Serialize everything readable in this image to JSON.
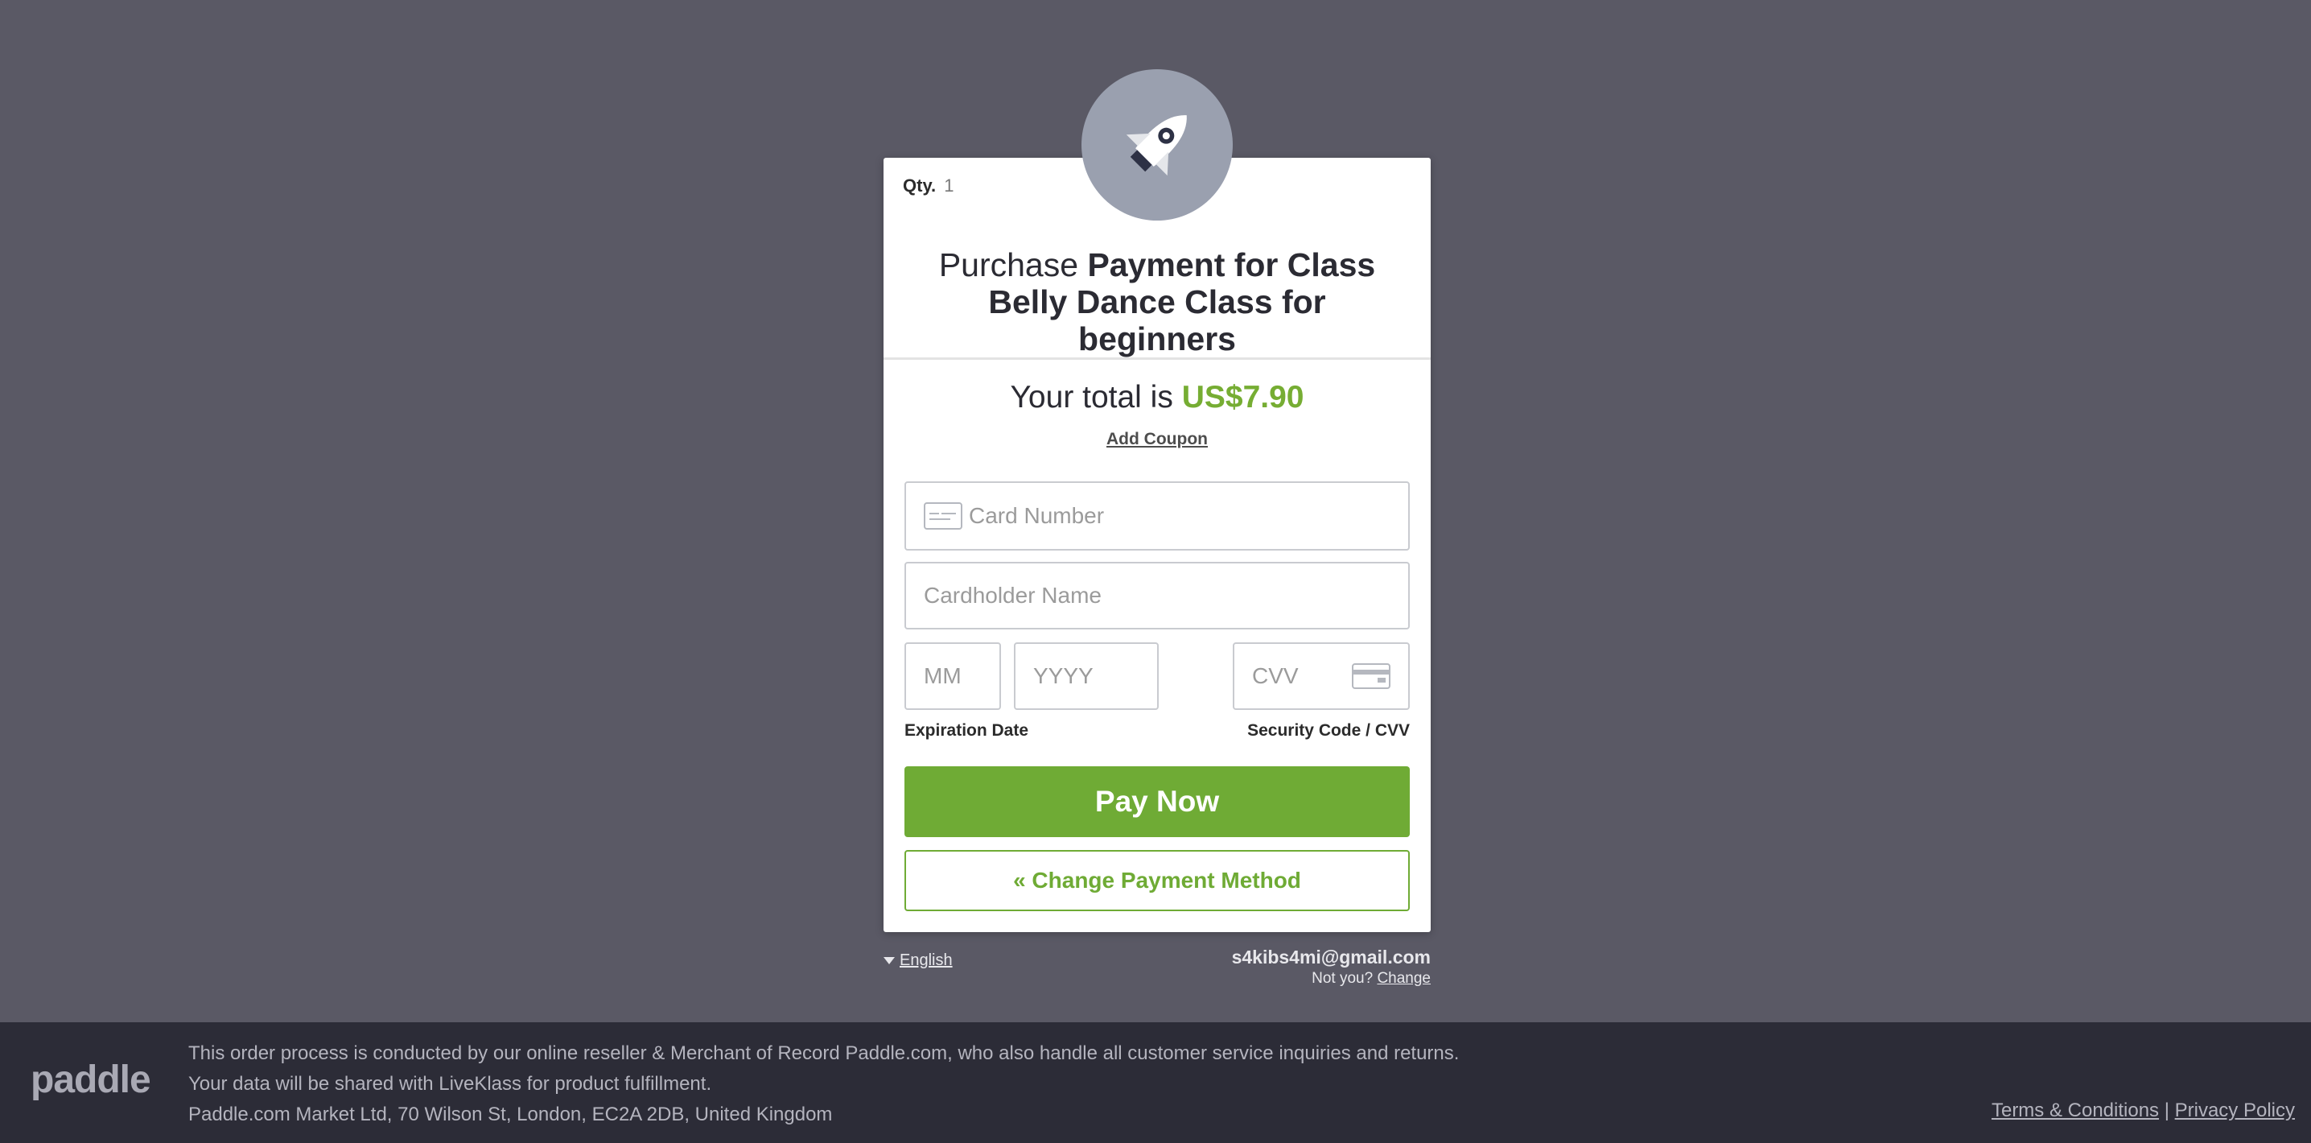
{
  "product": {
    "qty_label": "Qty.",
    "qty_value": "1",
    "title_prefix": "Purchase",
    "title_name": "Payment for Class Belly Dance Class for beginners",
    "icon": "rocket-icon"
  },
  "total": {
    "label": "Your total is",
    "amount": "US$7.90",
    "coupon_link": "Add Coupon"
  },
  "form": {
    "card_number_placeholder": "Card Number",
    "cardholder_placeholder": "Cardholder Name",
    "mm_placeholder": "MM",
    "yyyy_placeholder": "YYYY",
    "cvv_placeholder": "CVV",
    "expiration_label": "Expiration Date",
    "security_label": "Security Code / CVV",
    "pay_button": "Pay Now",
    "change_method_button": "« Change Payment Method"
  },
  "below_card": {
    "language": "English",
    "email": "s4kibs4mi@gmail.com",
    "not_you": "Not you?",
    "change_link": "Change"
  },
  "footer": {
    "logo": "paddle",
    "line1": "This order process is conducted by our online reseller & Merchant of Record Paddle.com, who also handle all customer service inquiries and returns.",
    "line2": "Your data will be shared with LiveKlass for product fulfillment.",
    "line3": "Paddle.com Market Ltd, 70 Wilson St, London, EC2A 2DB, United Kingdom",
    "terms": "Terms & Conditions",
    "separator": "|",
    "privacy": "Privacy Policy"
  },
  "colors": {
    "background": "#5a5965",
    "accent_green": "#6fab35",
    "amount_green": "#76ad33",
    "footer_bg": "#2c2c37"
  }
}
